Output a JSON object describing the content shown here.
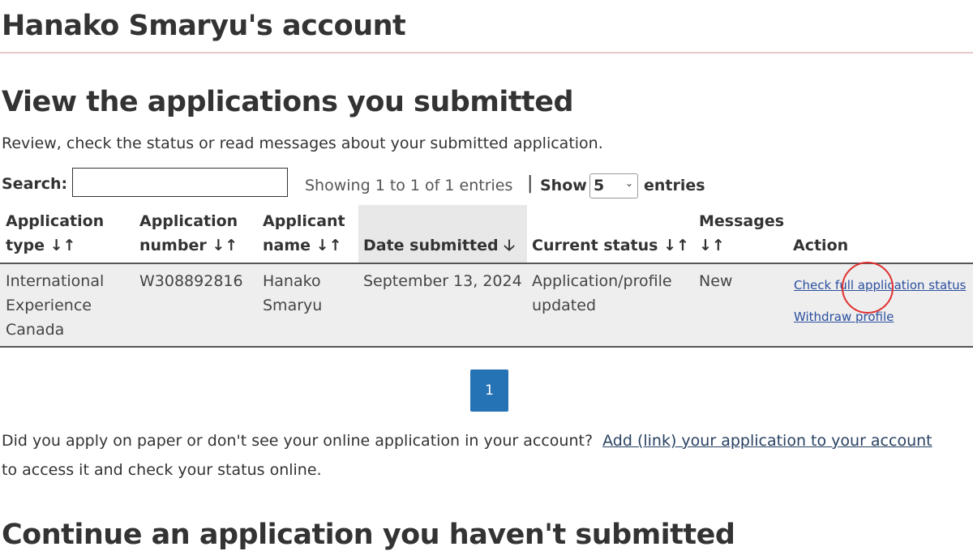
{
  "account_title": "Hanako Smaryu's account",
  "section_title": "View the applications you submitted",
  "lead": "Review, check the status or read messages about your submitted application.",
  "search": {
    "label": "Search:",
    "value": ""
  },
  "info": "Showing 1 to 1 of 1 entries",
  "separator": "|",
  "length": {
    "show": "Show",
    "value": "5",
    "entries": "entries"
  },
  "sort_icons": {
    "unsorted": "↓↑",
    "desc": "🡓"
  },
  "columns": [
    {
      "line1": "Application",
      "line2": "type"
    },
    {
      "line1": "Application",
      "line2": "number"
    },
    {
      "line1": "Applicant",
      "line2": "name"
    },
    {
      "line1": "",
      "line2": "Date submitted"
    },
    {
      "line1": "",
      "line2": "Current status"
    },
    {
      "line1": "Messages",
      "line2": ""
    },
    {
      "line1": "",
      "line2": "Action"
    }
  ],
  "rows": [
    {
      "type": "International Experience Canada",
      "number": "W308892816",
      "name": "Hanako Smaryu",
      "date": "September 13, 2024",
      "status": "Application/profile updated",
      "messages": "New",
      "actions": [
        "Check full application status",
        "Withdraw profile"
      ]
    }
  ],
  "pagination": {
    "current": "1"
  },
  "help": {
    "text": "Did you apply on paper or don't see your online application in your account?",
    "link": "Add (link) your application to your account",
    "after": "to access it and check your status online."
  },
  "next_section_title": "Continue an application you haven't submitted",
  "colors": {
    "primary": "#2572b4",
    "link": "#2b4f9e",
    "cursor_ring": "#e03030"
  }
}
